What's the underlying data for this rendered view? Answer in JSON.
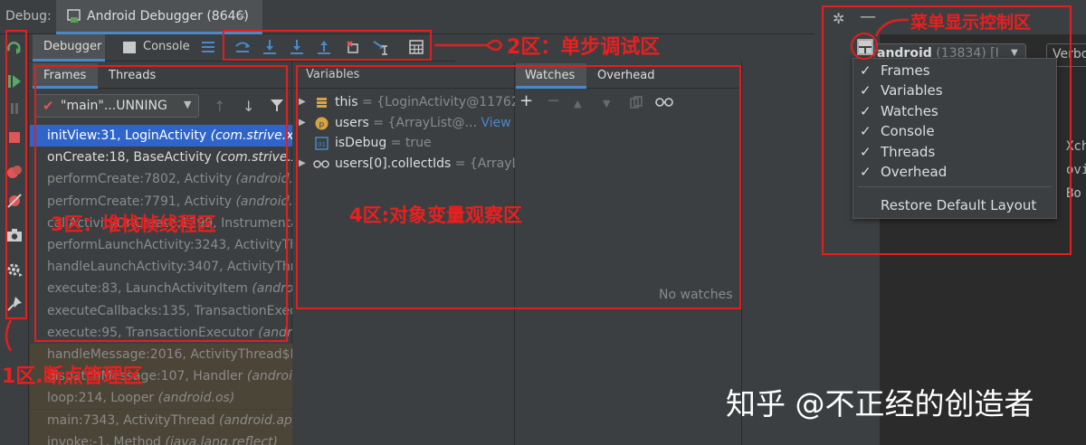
{
  "window": {
    "debug_label": "Debug:",
    "tab_title": "Android Debugger (8646)",
    "tab_close": "×"
  },
  "toolbar": {
    "debugger_tab": "Debugger",
    "console_tab": "Console"
  },
  "frames": {
    "tab_frames": "Frames",
    "tab_threads": "Threads",
    "thread_value": "\"main\"...UNNING",
    "rows": [
      {
        "method": "initView:31, LoginActivity ",
        "pkg": "(com.strive.xw",
        "style": "sel"
      },
      {
        "method": "onCreate:18, BaseActivity ",
        "pkg": "(com.strive.xw",
        "style": "normal"
      },
      {
        "method": "performCreate:7802, Activity ",
        "pkg": "(android.ap",
        "style": "dim"
      },
      {
        "method": "performCreate:7791, Activity ",
        "pkg": "(android.ap",
        "style": "dim"
      },
      {
        "method": "callActivityOnCreate:1299, Instrumentat",
        "pkg": "",
        "style": "dim"
      },
      {
        "method": "performLaunchActivity:3243, ActivityThr",
        "pkg": "",
        "style": "dim"
      },
      {
        "method": "handleLaunchActivity:3407, ActivityThre",
        "pkg": "",
        "style": "dim"
      },
      {
        "method": "execute:83, LaunchActivityItem ",
        "pkg": "(androi",
        "style": "dim"
      },
      {
        "method": "executeCallbacks:135, TransactionExec",
        "pkg": "",
        "style": "dim"
      },
      {
        "method": "execute:95, TransactionExecutor ",
        "pkg": "(andr",
        "style": "dim"
      },
      {
        "method": "handleMessage:2016, ActivityThread$H",
        "pkg": "",
        "style": "lib"
      },
      {
        "method": "dispatchMessage:107, Handler ",
        "pkg": "(androi",
        "style": "lib"
      },
      {
        "method": "loop:214, Looper ",
        "pkg": "(android.os)",
        "style": "lib"
      },
      {
        "method": "main:7343, ActivityThread ",
        "pkg": "(android.app)",
        "style": "lib"
      },
      {
        "method": "invoke:-1, Method ",
        "pkg": "(java.lang.reflect)",
        "style": "lib"
      }
    ]
  },
  "variables": {
    "header": "Variables",
    "rows": [
      {
        "name": "this",
        "value": " = {LoginActivity@11762}",
        "link": "",
        "icon": "field-icon",
        "expand": true
      },
      {
        "name": "users",
        "value": " = {ArrayList@... ",
        "link": "View",
        "icon": "parameter-icon",
        "expand": true
      },
      {
        "name": "isDebug",
        "value": " = true",
        "link": "",
        "icon": "primitive-icon",
        "expand": false
      },
      {
        "name": "users[0].collectIds",
        "value": " = {ArrayLi",
        "link": "",
        "icon": "watch-glasses-icon",
        "expand": true
      }
    ]
  },
  "watches": {
    "tab_watches": "Watches",
    "tab_overhead": "Overhead",
    "empty_text": "No watches"
  },
  "right": {
    "device_name": "android",
    "device_rest": " (13834) [I",
    "verbose": "Verbo",
    "code_lines": [
      "Xch",
      "ovi",
      "Bo"
    ]
  },
  "layout_menu": {
    "items": [
      {
        "label": "Frames",
        "checked": "✓"
      },
      {
        "label": "Variables",
        "checked": "✓"
      },
      {
        "label": "Watches",
        "checked": "✓"
      },
      {
        "label": "Console",
        "checked": "✓"
      },
      {
        "label": "Threads",
        "checked": "✓"
      },
      {
        "label": "Overhead",
        "checked": "✓"
      }
    ],
    "restore": "Restore Default Layout"
  },
  "annotations": {
    "zone1": "1区.断点管理区",
    "zone2": "2区：单步调试区",
    "zone3": "3区：堆栈帧线程区",
    "zone4": "4区:对象变量观察区",
    "menu_zone": "菜单显示控制区"
  },
  "watermark": "知乎 @不正经的创造者",
  "colors": {
    "accent": "#4a88c7",
    "selection": "#2f65ca",
    "annotation": "#e02020"
  }
}
